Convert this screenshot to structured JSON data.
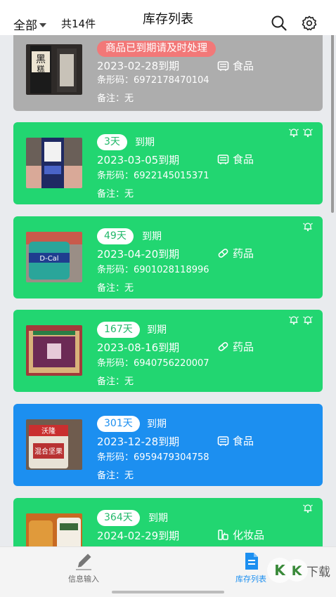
{
  "header": {
    "filter_label": "全部",
    "count_label": "共14件",
    "title": "库存列表"
  },
  "items": [
    {
      "status_text": "商品已到期请及时处理",
      "date": "2023-02-28到期",
      "category": "食品",
      "barcode": "条形码：6972178470104",
      "note": "备注：无",
      "color": "#adadad"
    },
    {
      "days": "3天",
      "expires_label": "到期",
      "date": "2023-03-05到期",
      "category": "食品",
      "barcode": "条形码：6922145015371",
      "note": "备注：无",
      "color": "#22d671"
    },
    {
      "days": "49天",
      "expires_label": "到期",
      "date": "2023-04-20到期",
      "category": "药品",
      "barcode": "条形码：6901028118996",
      "note": "备注：无",
      "color": "#22d671"
    },
    {
      "days": "167天",
      "expires_label": "到期",
      "date": "2023-08-16到期",
      "category": "药品",
      "barcode": "条形码：6940756220007",
      "note": "备注：无",
      "color": "#22d671"
    },
    {
      "days": "301天",
      "expires_label": "到期",
      "date": "2023-12-28到期",
      "category": "食品",
      "barcode": "条形码：6959479304758",
      "note": "备注：无",
      "color": "#1c8ff0"
    },
    {
      "days": "364天",
      "expires_label": "到期",
      "date": "2024-02-29到期",
      "category": "化妆品",
      "color": "#22d671"
    }
  ],
  "nav": {
    "info_label": "信息输入",
    "stock_label": "库存列表",
    "active_color": "#1c8ff0"
  },
  "watermark": "KK下载"
}
